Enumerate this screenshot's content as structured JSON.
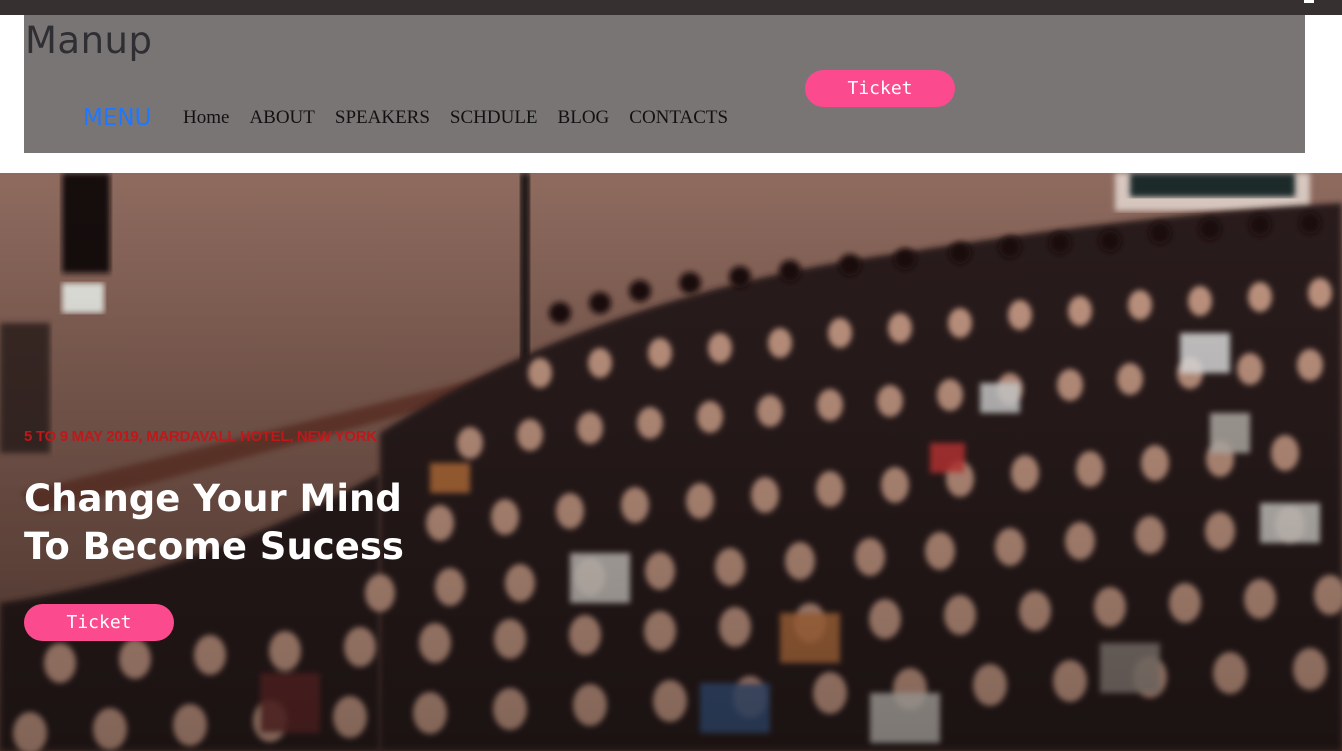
{
  "header": {
    "logo": "Manup",
    "menu_label": "MENU",
    "nav": [
      "Home",
      "ABOUT",
      "SPEAKERS",
      "SCHDULE",
      "BLOG",
      "CONTACTS"
    ],
    "ticket_label": "Ticket"
  },
  "hero": {
    "date_location": "5 TO 9 MAY 2019, MARDAVALL HOTEL, NEW YORK",
    "title_line1": "Change Your Mind",
    "title_line2": "To Become Sucess",
    "ticket_label": "Ticket"
  },
  "colors": {
    "accent": "#fb4b8e",
    "header_bg": "#7a7575",
    "menu_blue": "#1e78ff",
    "date_red": "#c0171a"
  }
}
